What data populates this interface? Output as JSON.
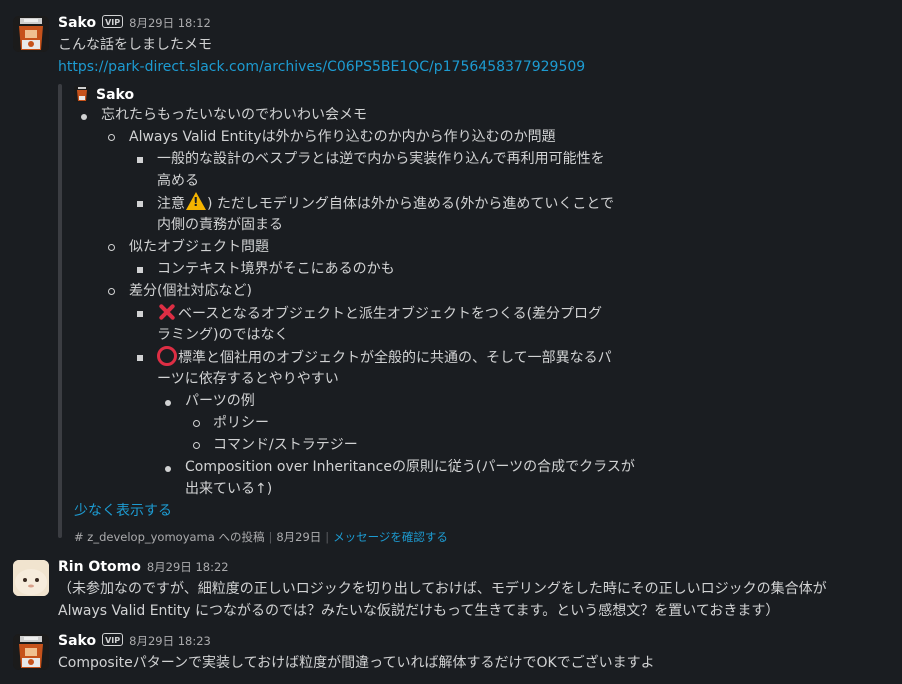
{
  "messages": {
    "m1": {
      "author": "Sako",
      "badge": "VIP",
      "timestamp": "8月29日 18:12",
      "text": "こんな話をしましたメモ",
      "link": "https://park-direct.slack.com/archives/C06PS5BE1QC/p1756458377929509",
      "quoted": {
        "author": "Sako",
        "items": {
          "l1": "忘れたらもったいないのでわいわい会メモ",
          "l2": "Always Valid Entityは外から作り込むのか内から作り込むのか問題",
          "l3a": "一般的な設計のベスプラとは逆で内から実装作り込んで再利用可能性を",
          "l3b": "高める",
          "l4pre": "注意",
          "l4a": ") ただしモデリング自体は外から進める(外から進めていくことで",
          "l4b": "内側の責務が固まる",
          "l5": "似たオブジェクト問題",
          "l6": "コンテキスト境界がそこにあるのかも",
          "l7": "差分(個社対応など)",
          "l8a": "ベースとなるオブジェクトと派生オブジェクトをつくる(差分プログ",
          "l8b": "ラミング)のではなく",
          "l9a": "標準と個社用のオブジェクトが全般的に共通の、そして一部異なるパ",
          "l9b": "ーツに依存するとやりやすい",
          "l10": "パーツの例",
          "l11": "ポリシー",
          "l12": "コマンド/ストラテジー",
          "l13a": "Composition over Inheritanceの原則に従う(パーツの合成でクラスが",
          "l13b": "出来ている↑)"
        },
        "show_less": "少なく表示する",
        "footer": {
          "channel": "# z_develop_yomoyama への投稿",
          "date": "8月29日",
          "view": "メッセージを確認する"
        }
      }
    },
    "m2": {
      "author": "Rin Otomo",
      "timestamp": "8月29日 18:22",
      "line1": "（未参加なのですが、細粒度の正しいロジックを切り出しておけば、モデリングをした時にその正しいロジックの集合体が",
      "line2": "Always Valid Entity につながるのでは？みたいな仮説だけもって生きてます。という感想文？を置いておきます）"
    },
    "m3": {
      "author": "Sako",
      "badge": "VIP",
      "timestamp": "8月29日 18:23",
      "text": "Compositeパターンで実装しておけば粒度が間違っていれば解体するだけでOKでございますよ"
    }
  },
  "icons": {
    "warning": "warning-emoji",
    "cross": "cross-mark-emoji",
    "circle": "heavy-large-circle-emoji"
  },
  "colors": {
    "background": "#1a1d21",
    "text": "#d1d2d3",
    "link": "#1d9bd1",
    "emoji_red": "#dd2e44",
    "emoji_yellow": "#f5b400"
  }
}
